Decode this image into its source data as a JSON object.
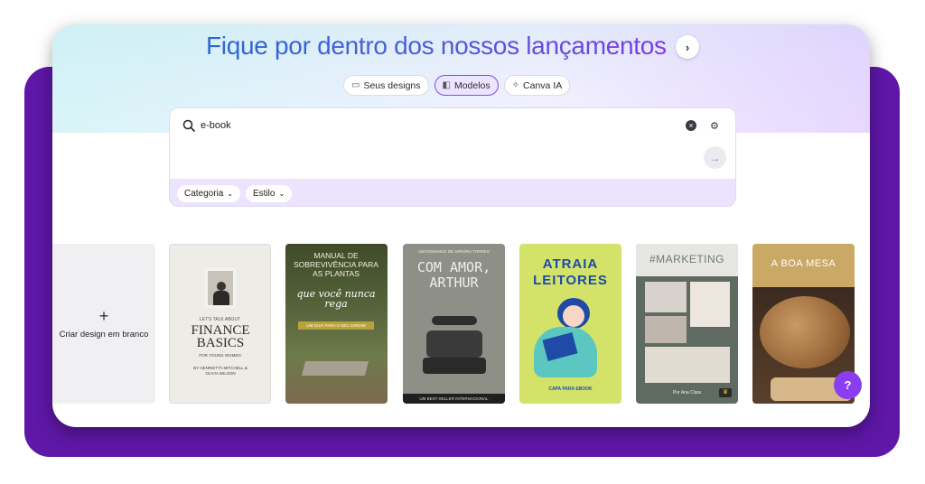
{
  "headline": {
    "text": "Fique por dentro dos nossos lançamentos",
    "arrow": "›"
  },
  "tabs": [
    {
      "label": "Seus designs",
      "icon": "folder-icon",
      "active": false
    },
    {
      "label": "Modelos",
      "icon": "template-icon",
      "active": true
    },
    {
      "label": "Canva IA",
      "icon": "sparkle-icon",
      "active": false
    }
  ],
  "search": {
    "value": "e-book",
    "submit": "→"
  },
  "filters": [
    {
      "label": "Categoria"
    },
    {
      "label": "Estilo"
    }
  ],
  "blank": {
    "plus": "+",
    "label": "Criar design em branco"
  },
  "templates": [
    {
      "kicker": "LET'S TALK ABOUT",
      "title": "FINANCE BASICS",
      "subtitle": "FOR YOUNG WOMEN",
      "authors": "BY HENRIETTA MITCHELL & OLIVIA WILSON"
    },
    {
      "title": "MANUAL DE SOBREVIVÊNCIA PARA AS PLANTAS",
      "script": "que você nunca rega",
      "subtitle": "UM GUIA PARA O SEU JARDIM"
    },
    {
      "kicker": "UM ROMANCE DE ARRORA TORRES",
      "title": "COM AMOR, ARTHUR",
      "footer": "UM BEST-SELLER INTERNACIONAL"
    },
    {
      "title": "ATRAIA LEITORES",
      "footer": "CAPA PARA EBOOK"
    },
    {
      "title": "#MARKETING",
      "footer": "Por Ana Clara"
    },
    {
      "title": "A BOA MESA"
    }
  ],
  "help": {
    "label": "?"
  },
  "colors": {
    "brand_purple": "#5e17a6",
    "accent": "#8b3df0"
  }
}
